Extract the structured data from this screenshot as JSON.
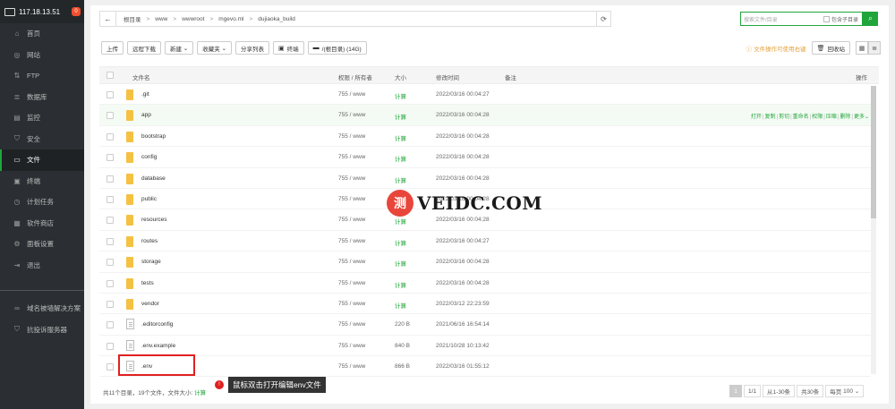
{
  "sidebar": {
    "server_ip": "117.18.13.51",
    "badge": "0",
    "items": [
      {
        "label": "首页",
        "icon": "home-icon",
        "glyph": "⌂"
      },
      {
        "label": "网站",
        "icon": "globe-icon",
        "glyph": "◎"
      },
      {
        "label": "FTP",
        "icon": "ftp-icon",
        "glyph": "⇅"
      },
      {
        "label": "数据库",
        "icon": "database-icon",
        "glyph": "≣"
      },
      {
        "label": "监控",
        "icon": "monitor-icon",
        "glyph": "▤"
      },
      {
        "label": "安全",
        "icon": "shield-icon",
        "glyph": "⛉"
      },
      {
        "label": "文件",
        "icon": "folder-icon",
        "glyph": "▭",
        "active": true
      },
      {
        "label": "终端",
        "icon": "terminal-icon",
        "glyph": "▣"
      },
      {
        "label": "计划任务",
        "icon": "clock-icon",
        "glyph": "◷"
      },
      {
        "label": "软件商店",
        "icon": "grid-icon",
        "glyph": "▦"
      },
      {
        "label": "面板设置",
        "icon": "gear-icon",
        "glyph": "⚙"
      },
      {
        "label": "退出",
        "icon": "logout-icon",
        "glyph": "⇥"
      }
    ],
    "extra": [
      {
        "label": "域名被墙解决方案",
        "icon": "link-icon",
        "glyph": "∞"
      },
      {
        "label": "抗投诉服务器",
        "icon": "shield-check-icon",
        "glyph": "⛉"
      }
    ]
  },
  "pathbar": {
    "crumbs": [
      "根目录",
      "www",
      "wwwroot",
      "mgevo.ml",
      "dujiaoka_build"
    ]
  },
  "search": {
    "placeholder": "搜索文件/目录",
    "include_sub": "包含子目录"
  },
  "toolbar": {
    "upload": "上传",
    "remote_download": "远程下载",
    "new": "新建",
    "favorites": "收藏夹",
    "share_list": "分享列表",
    "terminal": "终端",
    "disk": "/(根目录) (14G)",
    "warning": "文件操作可使用右键",
    "recycle": "回收站"
  },
  "table": {
    "headers": {
      "name": "文件名",
      "perm": "权限 / 所有者",
      "size": "大小",
      "mtime": "修改时间",
      "note": "备注",
      "ops": "操作"
    },
    "ops": [
      "打开",
      "复制",
      "剪切",
      "重命名",
      "权限",
      "压缩",
      "删除",
      "更多"
    ],
    "rows": [
      {
        "name": ".git",
        "type": "folder",
        "perm": "755 / www",
        "size": "计算",
        "mtime": "2022/03/16 00:04:27"
      },
      {
        "name": "app",
        "type": "folder",
        "perm": "755 / www",
        "size": "计算",
        "mtime": "2022/03/16 00:04:28"
      },
      {
        "name": "bootstrap",
        "type": "folder",
        "perm": "755 / www",
        "size": "计算",
        "mtime": "2022/03/16 00:04:28"
      },
      {
        "name": "config",
        "type": "folder",
        "perm": "755 / www",
        "size": "计算",
        "mtime": "2022/03/16 00:04:28"
      },
      {
        "name": "database",
        "type": "folder",
        "perm": "755 / www",
        "size": "计算",
        "mtime": "2022/03/16 00:04:28"
      },
      {
        "name": "public",
        "type": "folder",
        "perm": "755 / www",
        "size": "计算",
        "mtime": "2022/03/16 00:04:28"
      },
      {
        "name": "resources",
        "type": "folder",
        "perm": "755 / www",
        "size": "计算",
        "mtime": "2022/03/16 00:04:28"
      },
      {
        "name": "routes",
        "type": "folder",
        "perm": "755 / www",
        "size": "计算",
        "mtime": "2022/03/16 00:04:27"
      },
      {
        "name": "storage",
        "type": "folder",
        "perm": "755 / www",
        "size": "计算",
        "mtime": "2022/03/16 00:04:28"
      },
      {
        "name": "tests",
        "type": "folder",
        "perm": "755 / www",
        "size": "计算",
        "mtime": "2022/03/16 00:04:28"
      },
      {
        "name": "vendor",
        "type": "folder",
        "perm": "755 / www",
        "size": "计算",
        "mtime": "2022/03/12 22:23:59"
      },
      {
        "name": ".editorconfig",
        "type": "file",
        "perm": "755 / www",
        "size": "220 B",
        "mtime": "2021/06/16 16:54:14"
      },
      {
        "name": ".env.example",
        "type": "file",
        "perm": "755 / www",
        "size": "840 B",
        "mtime": "2021/10/28 10:13:42"
      },
      {
        "name": ".env",
        "type": "file",
        "perm": "755 / www",
        "size": "866 B",
        "mtime": "2022/03/16 01:55:12"
      }
    ]
  },
  "footer": {
    "summary": "共11个目录，19个文件，文件大小:",
    "calc": "计算"
  },
  "pager": {
    "current": "1",
    "pages": "1/1",
    "range": "从1-30条",
    "total": "共30条",
    "per_page": "每页",
    "per_page_value": "100"
  },
  "annotation": {
    "dot": "!",
    "text": "鼠标双击打开编辑env文件"
  },
  "watermark": {
    "logo": "测",
    "text": "VEIDC.COM"
  },
  "colors": {
    "accent": "#20a53a",
    "sidebar": "#2b2f33",
    "highlight": "#e02020"
  }
}
